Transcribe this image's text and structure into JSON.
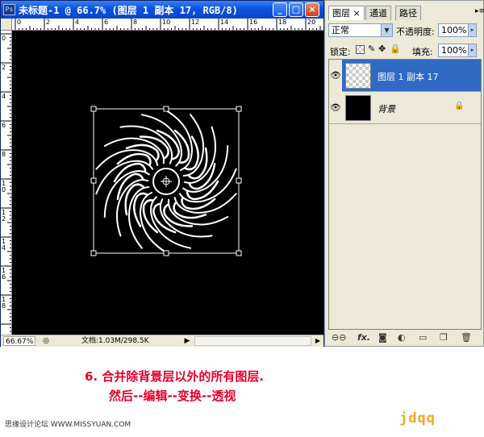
{
  "document": {
    "title": "未标题-1 @ 66.7% (图层 1 副本 17, RGB/8)",
    "ruler_h_labels": [
      "0",
      "2",
      "4",
      "6",
      "8",
      "10",
      "12",
      "14",
      "16",
      "18",
      "20"
    ],
    "ruler_v_labels": [
      "0",
      "2",
      "4",
      "6",
      "8",
      "1\n0",
      "1\n2",
      "1\n4",
      "1\n6",
      "1\n8"
    ],
    "status": {
      "zoom": "66.67%",
      "doc_size": "文档:1.03M/298.5K"
    },
    "window_buttons": {
      "minimize": "_",
      "maximize": "□",
      "close": "×"
    }
  },
  "panel": {
    "tabs": [
      {
        "label": "图层 ×"
      },
      {
        "label": "通道"
      },
      {
        "label": "路径"
      }
    ],
    "blend_mode": "正常",
    "opacity_label": "不透明度:",
    "opacity_value": "100%",
    "lock_label": "锁定:",
    "fill_label": "填充:",
    "fill_value": "100%",
    "layers": [
      {
        "name": "图层 1 副本 17",
        "selected": true
      },
      {
        "name": "背景",
        "selected": false
      }
    ],
    "bottom_icons": [
      "link-icon",
      "fx-icon",
      "mask-icon",
      "adjustment-icon",
      "group-icon",
      "new-layer-icon",
      "trash-icon"
    ],
    "fx_label": "fx."
  },
  "caption": {
    "line1": "6. 合并除背景层以外的所有图层.",
    "line2": "然后--编辑--变换--透视"
  },
  "footer": {
    "site": "思缘设计论坛 WWW.MISSYUAN.COM",
    "brand": "jdqq"
  },
  "colors": {
    "caption": "#e4002b",
    "brand": "#f5a623",
    "selected_layer": "#316ac5"
  }
}
